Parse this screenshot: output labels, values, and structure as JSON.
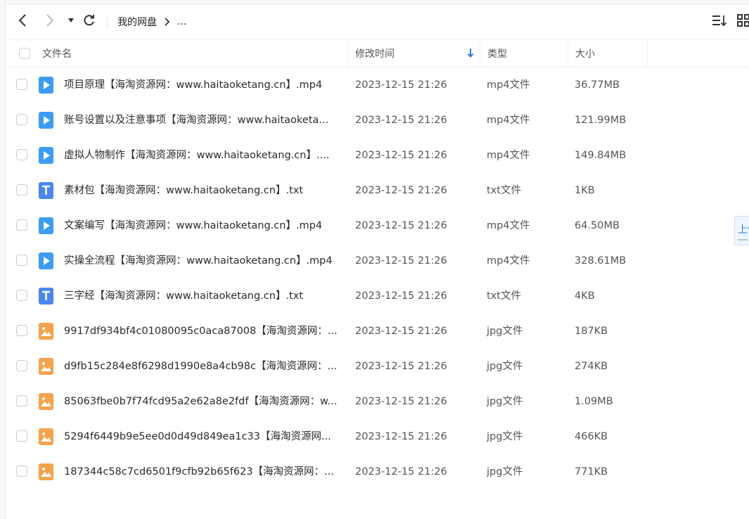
{
  "toolbar": {
    "back_icon": "chevron-left-icon",
    "forward_icon": "chevron-right-icon",
    "dropdown_icon": "caret-down-icon",
    "refresh_icon": "refresh-icon",
    "sort_icon": "sort-list-icon",
    "grid_icon": "grid-view-icon"
  },
  "breadcrumb": {
    "root": "我的网盘",
    "more": "..."
  },
  "table": {
    "columns": {
      "name": "文件名",
      "modified": "修改时间",
      "type": "类型",
      "size": "大小"
    },
    "sort": {
      "column": "modified",
      "direction": "descending"
    },
    "rows": [
      {
        "icon": "video",
        "name": "项目原理【海淘资源网：www.haitaoketang.cn】.mp4",
        "modified": "2023-12-15 21:26",
        "type": "mp4文件",
        "size": "36.77MB"
      },
      {
        "icon": "video",
        "name": "账号设置以及注意事项【海淘资源网：www.haitaoketa...",
        "modified": "2023-12-15 21:26",
        "type": "mp4文件",
        "size": "121.99MB"
      },
      {
        "icon": "video",
        "name": "虚拟人物制作【海淘资源网：www.haitaoketang.cn】....",
        "modified": "2023-12-15 21:26",
        "type": "mp4文件",
        "size": "149.84MB"
      },
      {
        "icon": "text",
        "name": "素材包【海淘资源网：www.haitaoketang.cn】.txt",
        "modified": "2023-12-15 21:26",
        "type": "txt文件",
        "size": "1KB"
      },
      {
        "icon": "video",
        "name": "文案编写【海淘资源网：www.haitaoketang.cn】.mp4",
        "modified": "2023-12-15 21:26",
        "type": "mp4文件",
        "size": "64.50MB"
      },
      {
        "icon": "video",
        "name": "实操全流程【海淘资源网：www.haitaoketang.cn】.mp4",
        "modified": "2023-12-15 21:26",
        "type": "mp4文件",
        "size": "328.61MB"
      },
      {
        "icon": "text",
        "name": "三字经【海淘资源网：www.haitaoketang.cn】.txt",
        "modified": "2023-12-15 21:26",
        "type": "txt文件",
        "size": "4KB"
      },
      {
        "icon": "image",
        "name": "9917df934bf4c01080095c0aca87008【海淘资源网：...",
        "modified": "2023-12-15 21:26",
        "type": "jpg文件",
        "size": "187KB"
      },
      {
        "icon": "image",
        "name": "d9fb15c284e8f6298d1990e8a4cb98c【海淘资源网：...",
        "modified": "2023-12-15 21:26",
        "type": "jpg文件",
        "size": "274KB"
      },
      {
        "icon": "image",
        "name": "85063fbe0b7f74fcd95a2e62a8e2fdf【海淘资源网：w...",
        "modified": "2023-12-15 21:26",
        "type": "jpg文件",
        "size": "1.09MB"
      },
      {
        "icon": "image",
        "name": "5294f6449b9e5ee0d0d49d849ea1c33【海淘资源网...",
        "modified": "2023-12-15 21:26",
        "type": "jpg文件",
        "size": "466KB"
      },
      {
        "icon": "image",
        "name": "187344c58c7cd6501f9cfb92b65f623【海淘资源网：...",
        "modified": "2023-12-15 21:26",
        "type": "jpg文件",
        "size": "771KB"
      }
    ]
  },
  "float_tab": {
    "label": "上传"
  },
  "colors": {
    "video_icon": "#3b9cf5",
    "text_icon": "#4a86f0",
    "image_icon": "#f6a24a",
    "accent": "#2a7de1"
  }
}
